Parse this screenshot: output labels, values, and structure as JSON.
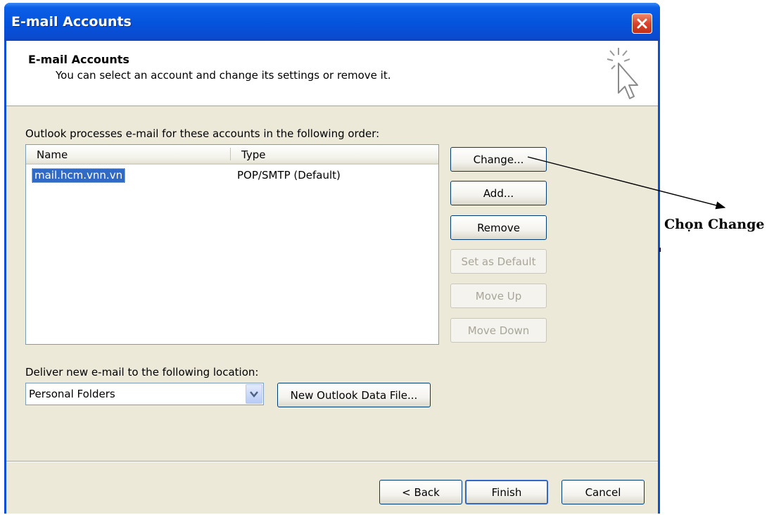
{
  "window": {
    "title": "E-mail Accounts",
    "close_icon": "close-x-icon"
  },
  "header": {
    "title": "E-mail Accounts",
    "subtitle": "You can select an account and change its settings or remove it.",
    "icon": "sparkle-cursor-icon"
  },
  "accounts": {
    "caption": "Outlook processes e-mail for these accounts in the following order:",
    "columns": [
      "Name",
      "Type"
    ],
    "rows": [
      {
        "name": "mail.hcm.vnn.vn",
        "type": "POP/SMTP (Default)",
        "selected": true
      }
    ]
  },
  "side_buttons": {
    "change": "Change...",
    "add": "Add...",
    "remove": "Remove",
    "set_default": "Set as Default",
    "move_up": "Move Up",
    "move_down": "Move Down"
  },
  "deliver": {
    "caption": "Deliver new e-mail to the following location:",
    "selected": "Personal Folders",
    "new_data_file": "New Outlook Data File..."
  },
  "footer": {
    "back": "< Back",
    "finish": "Finish",
    "cancel": "Cancel"
  },
  "annotation": {
    "text": "Chọn Change"
  },
  "colors": {
    "titlebar": "#0553dc",
    "client": "#ece9d8",
    "selection": "#316ac5",
    "close": "#d8442a"
  }
}
